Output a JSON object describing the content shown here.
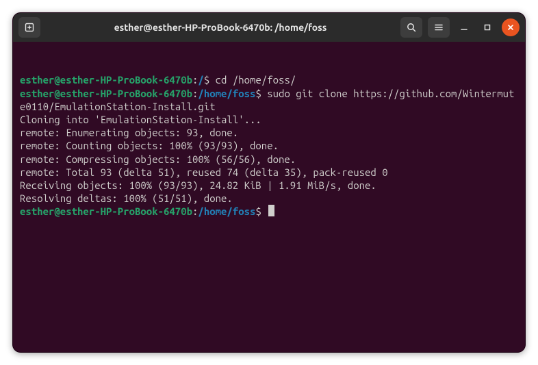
{
  "titlebar": {
    "title": "esther@esther-HP-ProBook-6470b: /home/foss"
  },
  "terminal": {
    "prompt1": {
      "user": "esther@esther-HP-ProBook-6470b",
      "sep": ":",
      "path": "/",
      "dollar": "$ ",
      "cmd": "cd /home/foss/"
    },
    "prompt2": {
      "user": "esther@esther-HP-ProBook-6470b",
      "sep": ":",
      "path": "/home/foss",
      "dollar": "$ ",
      "cmd": "sudo git clone https://github.com/Wintermute0110/EmulationStation-Install.git"
    },
    "out1": "Cloning into 'EmulationStation-Install'...",
    "out2": "remote: Enumerating objects: 93, done.",
    "out3": "remote: Counting objects: 100% (93/93), done.",
    "out4": "remote: Compressing objects: 100% (56/56), done.",
    "out5": "remote: Total 93 (delta 51), reused 74 (delta 35), pack-reused 0",
    "out6": "Receiving objects: 100% (93/93), 24.82 KiB | 1.91 MiB/s, done.",
    "out7": "Resolving deltas: 100% (51/51), done.",
    "prompt3": {
      "user": "esther@esther-HP-ProBook-6470b",
      "sep": ":",
      "path": "/home/foss",
      "dollar": "$ "
    }
  }
}
